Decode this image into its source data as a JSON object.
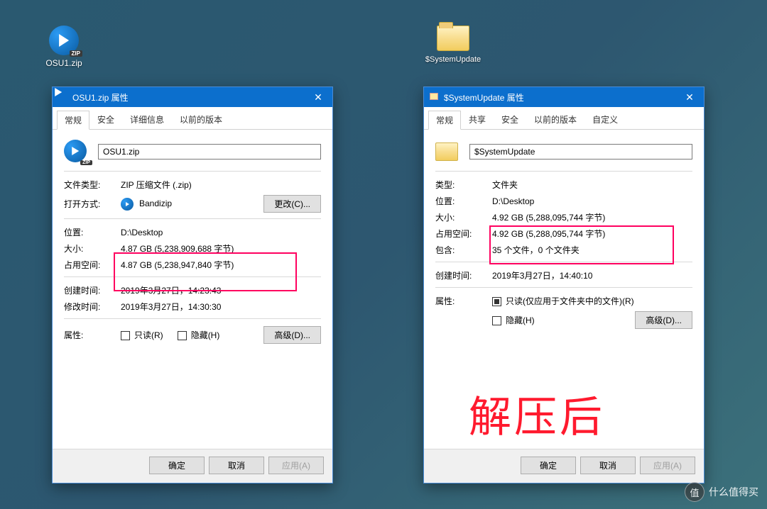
{
  "desktop": {
    "zip_label": "OSU1.zip",
    "folder_label": "$SystemUpdate"
  },
  "dialog1": {
    "title": "OSU1.zip 属性",
    "tabs": [
      "常规",
      "安全",
      "详细信息",
      "以前的版本"
    ],
    "filename": "OSU1.zip",
    "rows": {
      "type_k": "文件类型:",
      "type_v": "ZIP 压缩文件 (.zip)",
      "open_k": "打开方式:",
      "open_v": "Bandizip",
      "change_btn": "更改(C)...",
      "loc_k": "位置:",
      "loc_v": "D:\\Desktop",
      "size_k": "大小:",
      "size_v": "4.87 GB (5,238,909,688 字节)",
      "disk_k": "占用空间:",
      "disk_v": "4.87 GB (5,238,947,840 字节)",
      "ctime_k": "创建时间:",
      "ctime_v": "2019年3月27日，14:23:43",
      "mtime_k": "修改时间:",
      "mtime_v": "2019年3月27日，14:30:30",
      "attr_k": "属性:",
      "readonly": "只读(R)",
      "hidden": "隐藏(H)",
      "adv_btn": "高级(D)..."
    },
    "footer": {
      "ok": "确定",
      "cancel": "取消",
      "apply": "应用(A)"
    }
  },
  "dialog2": {
    "title": "$SystemUpdate 属性",
    "tabs": [
      "常规",
      "共享",
      "安全",
      "以前的版本",
      "自定义"
    ],
    "filename": "$SystemUpdate",
    "rows": {
      "type_k": "类型:",
      "type_v": "文件夹",
      "loc_k": "位置:",
      "loc_v": "D:\\Desktop",
      "size_k": "大小:",
      "size_v": "4.92 GB (5,288,095,744 字节)",
      "disk_k": "占用空间:",
      "disk_v": "4.92 GB (5,288,095,744 字节)",
      "contains_k": "包含:",
      "contains_v": "35 个文件，0 个文件夹",
      "ctime_k": "创建时间:",
      "ctime_v": "2019年3月27日，14:40:10",
      "attr_k": "属性:",
      "readonly": "只读(仅应用于文件夹中的文件)(R)",
      "hidden": "隐藏(H)",
      "adv_btn": "高级(D)..."
    },
    "footer": {
      "ok": "确定",
      "cancel": "取消",
      "apply": "应用(A)"
    }
  },
  "annotation": {
    "bigtext": "解压后"
  },
  "watermark": {
    "glyph": "值",
    "text": "什么值得买"
  }
}
